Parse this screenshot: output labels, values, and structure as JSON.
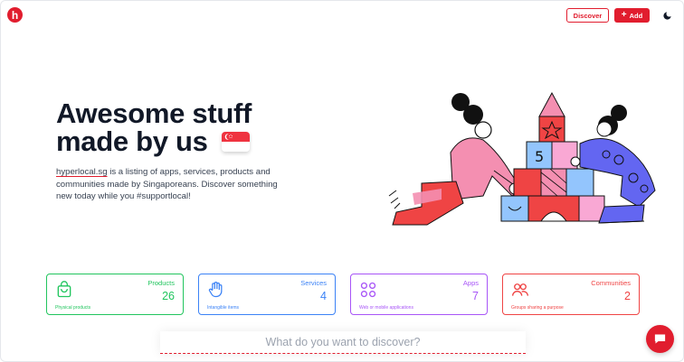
{
  "brand": {
    "logo_letter": "h",
    "color": "#e11d2e"
  },
  "header": {
    "discover_label": "Discover",
    "add_label": "Add",
    "add_icon": "plus-icon",
    "theme_icon": "moon-icon"
  },
  "hero": {
    "title_line1": "Awesome stuff",
    "title_line2": "made by us",
    "flag_icon": "singapore-flag-icon",
    "desc_link": "hyperlocal.sg",
    "desc_rest": " is a listing of apps, services, products and communities made by Singaporeans. Discover something new today while you #supportlocal!"
  },
  "categories": [
    {
      "title": "Products",
      "count": "26",
      "subtitle": "Physical products",
      "icon": "shopping-bag-icon",
      "color": "#22c55e"
    },
    {
      "title": "Services",
      "count": "4",
      "subtitle": "Intangible items",
      "icon": "waving-hand-icon",
      "color": "#3b82f6"
    },
    {
      "title": "Apps",
      "count": "7",
      "subtitle": "Web or mobile applications",
      "icon": "apps-grid-icon",
      "color": "#a855f7"
    },
    {
      "title": "Communities",
      "count": "2",
      "subtitle": "Groups sharing a purpose",
      "icon": "users-icon",
      "color": "#ef4444"
    }
  ],
  "search": {
    "placeholder": "What do you want to discover?"
  },
  "chat": {
    "icon": "chat-icon"
  },
  "illustration": {
    "block_number": "5"
  }
}
